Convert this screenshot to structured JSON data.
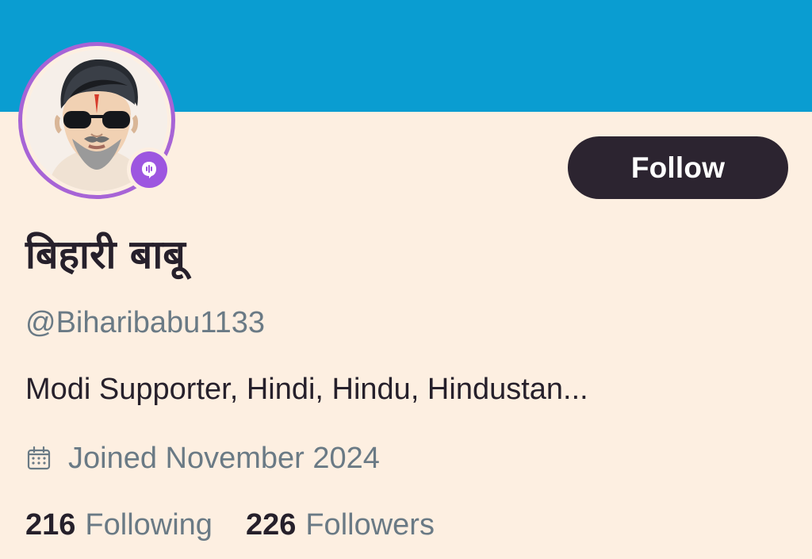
{
  "colors": {
    "banner": "#0a9dd1",
    "page_background": "#fdefe1",
    "avatar_ring": "#a764d6",
    "badge": "#9d56e0",
    "follow_button": "#2c2430",
    "follow_text": "#ffffff",
    "primary_text": "#26202b",
    "secondary_text": "#6a7a85"
  },
  "profile": {
    "display_name": "बिहारी बाबू",
    "handle": "@Biharibabu1133",
    "bio": "Modi Supporter, Hindi, Hindu, Hindustan...",
    "joined": "Joined November 2024",
    "avatar_icon": "profile-avatar-illustration",
    "badge_icon": "audio-badge-icon",
    "joined_icon": "calendar-icon"
  },
  "actions": {
    "follow_label": "Follow"
  },
  "stats": {
    "following_count": "216",
    "following_label": "Following",
    "followers_count": "226",
    "followers_label": "Followers"
  }
}
